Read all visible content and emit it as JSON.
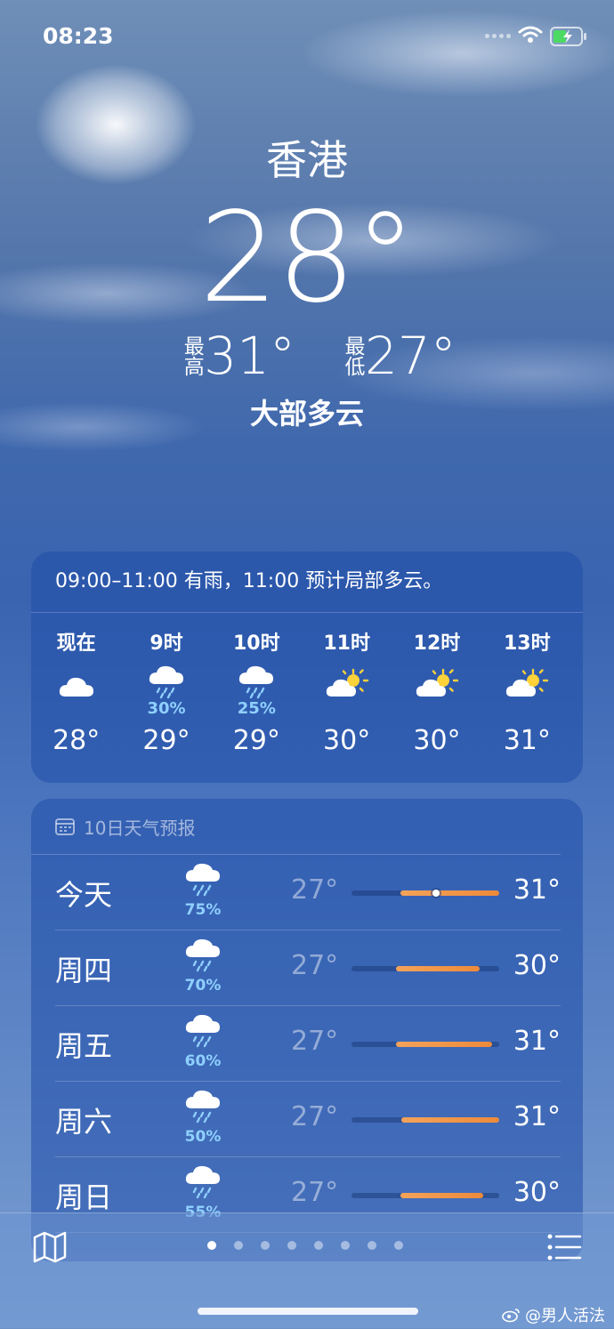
{
  "status_bar": {
    "time": "08:23"
  },
  "location": {
    "city": "香港",
    "temperature": "28°",
    "high_label": "最高",
    "high": "31°",
    "low_label": "最低",
    "low": "27°",
    "condition": "大部多云"
  },
  "hourly": {
    "summary": "09:00–11:00 有雨，11:00 预计局部多云。",
    "items": [
      {
        "label": "现在",
        "icon": "cloud-icon",
        "precip": "",
        "temp": "28°"
      },
      {
        "label": "9时",
        "icon": "cloud-rain-icon",
        "precip": "30%",
        "temp": "29°"
      },
      {
        "label": "10时",
        "icon": "cloud-rain-icon",
        "precip": "25%",
        "temp": "29°"
      },
      {
        "label": "11时",
        "icon": "sun-cloud-icon",
        "precip": "",
        "temp": "30°"
      },
      {
        "label": "12时",
        "icon": "sun-cloud-icon",
        "precip": "",
        "temp": "30°"
      },
      {
        "label": "13时",
        "icon": "sun-cloud-icon",
        "precip": "",
        "temp": "31°"
      }
    ]
  },
  "daily": {
    "header": "10日天气预报",
    "items": [
      {
        "name": "今天",
        "icon": "cloud-rain-icon",
        "precip": "75%",
        "low": "27°",
        "high": "31°",
        "range_start": 0.33,
        "range_end": 1.0,
        "current": 0.57
      },
      {
        "name": "周四",
        "icon": "cloud-rain-icon",
        "precip": "70%",
        "low": "27°",
        "high": "30°",
        "range_start": 0.3,
        "range_end": 0.87
      },
      {
        "name": "周五",
        "icon": "cloud-rain-icon",
        "precip": "60%",
        "low": "27°",
        "high": "31°",
        "range_start": 0.3,
        "range_end": 0.95
      },
      {
        "name": "周六",
        "icon": "cloud-rain-icon",
        "precip": "50%",
        "low": "27°",
        "high": "31°",
        "range_start": 0.34,
        "range_end": 1.0
      },
      {
        "name": "周日",
        "icon": "cloud-rain-icon",
        "precip": "55%",
        "low": "27°",
        "high": "30°",
        "range_start": 0.33,
        "range_end": 0.89
      }
    ]
  },
  "pager": {
    "count": 8,
    "active": 0
  },
  "watermark": "@男人活法"
}
